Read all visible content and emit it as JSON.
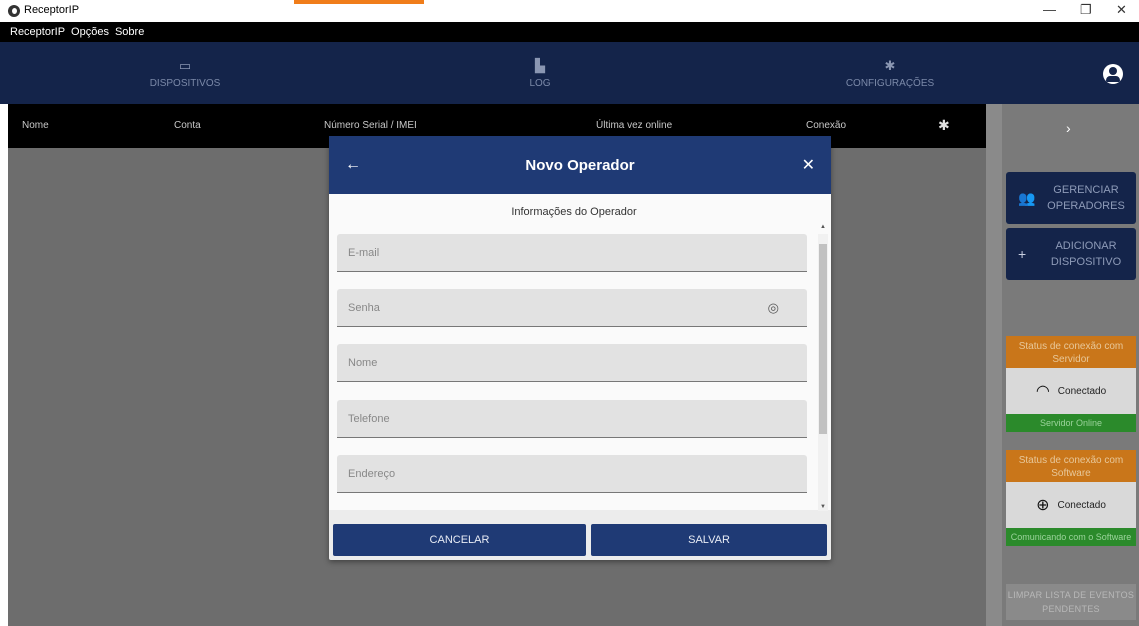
{
  "window": {
    "title": "ReceptorIP",
    "minimize": "—",
    "maximize": "❐",
    "close": "✕"
  },
  "menu": [
    "ReceptorIP",
    "Opções",
    "Sobre"
  ],
  "nav": {
    "tabs": [
      {
        "label": "DISPOSITIVOS",
        "icon": "devices-icon"
      },
      {
        "label": "LOG",
        "icon": "log-icon"
      },
      {
        "label": "CONFIGURAÇÕES",
        "icon": "gear-icon"
      }
    ]
  },
  "table": {
    "headers": [
      "Nome",
      "Conta",
      "Número Serial / IMEI",
      "Última vez online",
      "Conexão"
    ]
  },
  "right_panel": {
    "manage_operators": "GERENCIAR OPERADORES",
    "add_device": "ADICIONAR DISPOSITIVO",
    "server_status": {
      "title": "Status de conexão com Servidor",
      "state": "Conectado",
      "detail": "Servidor Online"
    },
    "software_status": {
      "title": "Status de conexão com Software",
      "state": "Conectado",
      "detail": "Comunicando com o Software"
    },
    "clear_events": "LIMPAR LISTA DE EVENTOS PENDENTES"
  },
  "modal": {
    "title": "Novo Operador",
    "section": "Informações do Operador",
    "fields": [
      {
        "placeholder": "E-mail",
        "value": ""
      },
      {
        "placeholder": "Senha",
        "value": ""
      },
      {
        "placeholder": "Nome",
        "value": ""
      },
      {
        "placeholder": "Telefone",
        "value": ""
      },
      {
        "placeholder": "Endereço",
        "value": ""
      }
    ],
    "cancel": "CANCELAR",
    "save": "SALVAR"
  },
  "colors": {
    "navy": "#14244a",
    "modal_header": "#1f3a75",
    "orange": "#c9761a",
    "green": "#2b8a2b"
  }
}
